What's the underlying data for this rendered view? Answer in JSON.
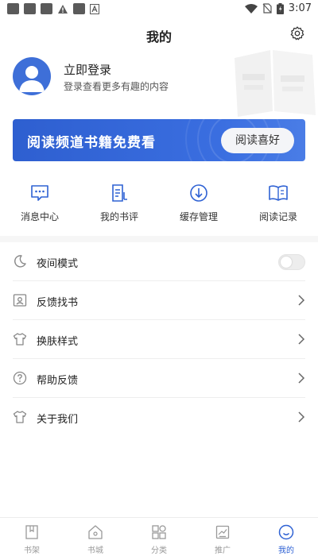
{
  "status_bar": {
    "time": "3:07"
  },
  "header": {
    "title": "我的"
  },
  "profile": {
    "title": "立即登录",
    "subtitle": "登录查看更多有趣的内容"
  },
  "banner": {
    "text": "阅读频道书籍免费看",
    "button": "阅读喜好"
  },
  "quick_actions": [
    {
      "label": "消息中心",
      "icon": "message-icon"
    },
    {
      "label": "我的书评",
      "icon": "review-icon"
    },
    {
      "label": "缓存管理",
      "icon": "download-icon"
    },
    {
      "label": "阅读记录",
      "icon": "book-open-icon"
    }
  ],
  "settings_list": [
    {
      "label": "夜间模式",
      "icon": "moon-icon",
      "type": "toggle",
      "on": false
    },
    {
      "label": "反馈找书",
      "icon": "find-book-icon",
      "type": "link"
    },
    {
      "label": "换肤样式",
      "icon": "shirt-icon",
      "type": "link"
    },
    {
      "label": "帮助反馈",
      "icon": "help-icon",
      "type": "link"
    },
    {
      "label": "关于我们",
      "icon": "shirt-icon",
      "type": "link"
    }
  ],
  "bottom_nav": [
    {
      "label": "书架",
      "icon": "bookshelf-icon",
      "active": false
    },
    {
      "label": "书城",
      "icon": "bookstore-icon",
      "active": false
    },
    {
      "label": "分类",
      "icon": "category-icon",
      "active": false
    },
    {
      "label": "推广",
      "icon": "promote-icon",
      "active": false
    },
    {
      "label": "我的",
      "icon": "profile-smile-icon",
      "active": true
    }
  ],
  "colors": {
    "accent": "#2f62d4",
    "banner": "#3a6ee0",
    "text": "#222222",
    "muted": "#999999"
  }
}
